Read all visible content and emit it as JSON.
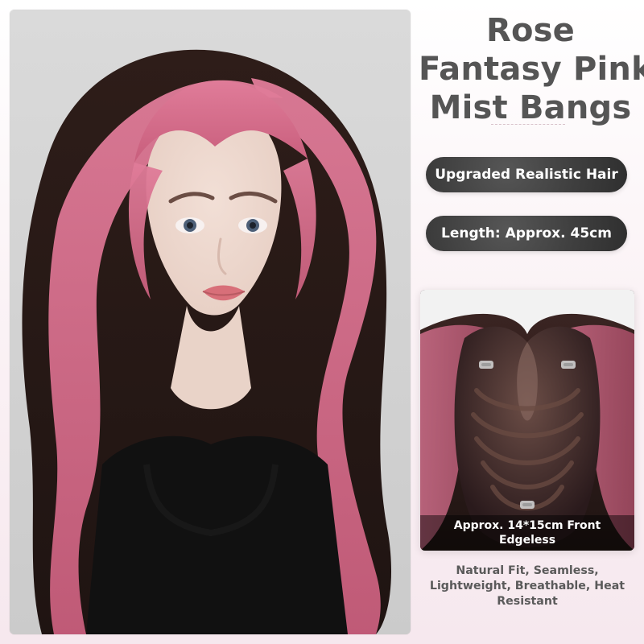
{
  "title": {
    "line1": "Rose",
    "line2": "Fantasy Pink",
    "line3": "Mist Bangs"
  },
  "badges": [
    {
      "label": "Upgraded Realistic Hair"
    },
    {
      "label": "Length: Approx. 45cm"
    }
  ],
  "detail": {
    "caption_line1": "Approx. 14*15cm Front",
    "caption_line2": "Edgeless"
  },
  "features": {
    "line1": "Natural Fit, Seamless,",
    "line2": "Lightweight, Breathable, Heat",
    "line3": "Resistant"
  },
  "colors": {
    "title_text": "#555555",
    "badge_bg": "#3f3f3f",
    "hair_dark": "#2b1a16",
    "hair_pink": "#d16a8a",
    "background_tint": "#f6e8ee"
  }
}
